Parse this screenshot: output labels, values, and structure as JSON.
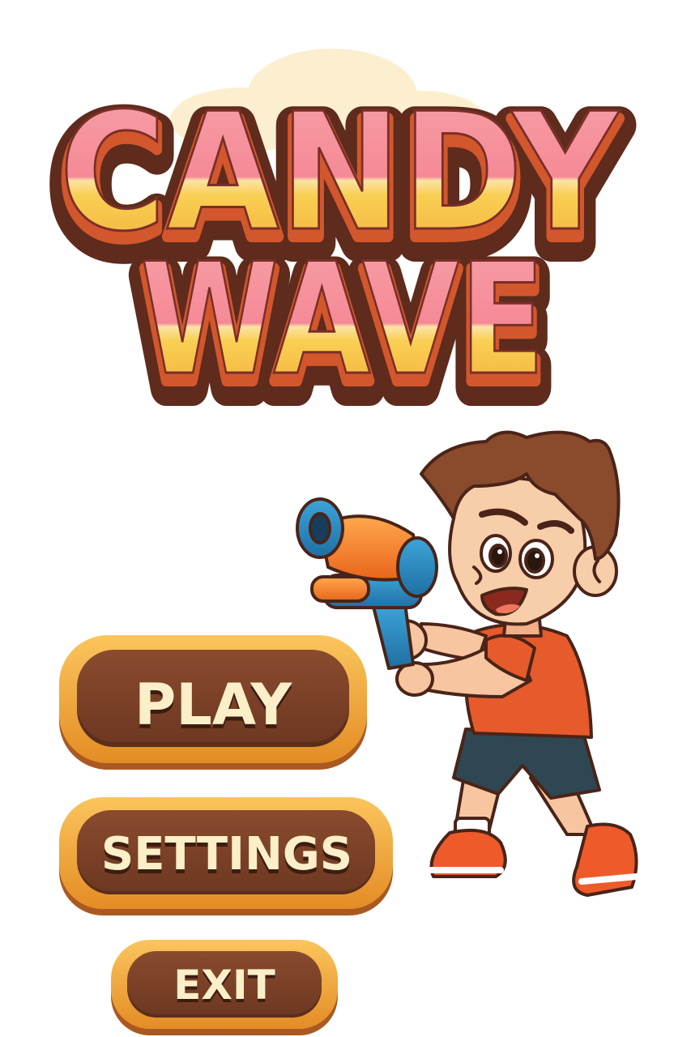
{
  "title": {
    "line1": "CANDY",
    "line2": "WAVE"
  },
  "menu": {
    "play_label": "PLAY",
    "settings_label": "SETTINGS",
    "exit_label": "EXIT"
  },
  "colors": {
    "candy_pink": "#f58a96",
    "candy_yellow": "#f7c43f",
    "outline_brown": "#6b3323",
    "button_gold": "#f3a93b",
    "button_brown": "#7a4128",
    "button_text": "#fbefc9",
    "glow_cream": "#fcefcf"
  },
  "character": {
    "name": "boy-with-water-gun-icon"
  }
}
